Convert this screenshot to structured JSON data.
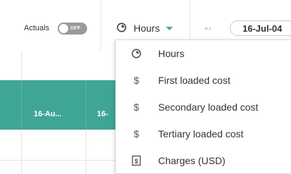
{
  "toolbar": {
    "actuals_label": "Actuals",
    "actuals_toggle": {
      "state_text": "OFF",
      "on": false
    },
    "units_selector": {
      "icon": "clock-icon",
      "label": "Hours",
      "caret": "caret-down-icon"
    },
    "date_nav": {
      "arrows_text": "«‹",
      "date_value": "16-Jul-04"
    }
  },
  "grid": {
    "columns": [
      {
        "label": "16-Au..."
      },
      {
        "label": "16-"
      }
    ],
    "header_color": "#3fa594"
  },
  "units_menu": {
    "items": [
      {
        "icon": "clock-icon",
        "glyph": "◷",
        "label": "Hours"
      },
      {
        "icon": "dollar-icon",
        "glyph": "$",
        "label": "First loaded cost"
      },
      {
        "icon": "dollar-icon",
        "glyph": "$",
        "label": "Secondary loaded cost"
      },
      {
        "icon": "dollar-icon",
        "glyph": "$",
        "label": "Tertiary loaded cost"
      },
      {
        "icon": "charges-icon",
        "glyph": "$",
        "label": "Charges (USD)"
      }
    ]
  },
  "colors": {
    "accent": "#4aa3a0",
    "toggle_off": "#9a9a9a",
    "teal_header": "#3fa594"
  }
}
